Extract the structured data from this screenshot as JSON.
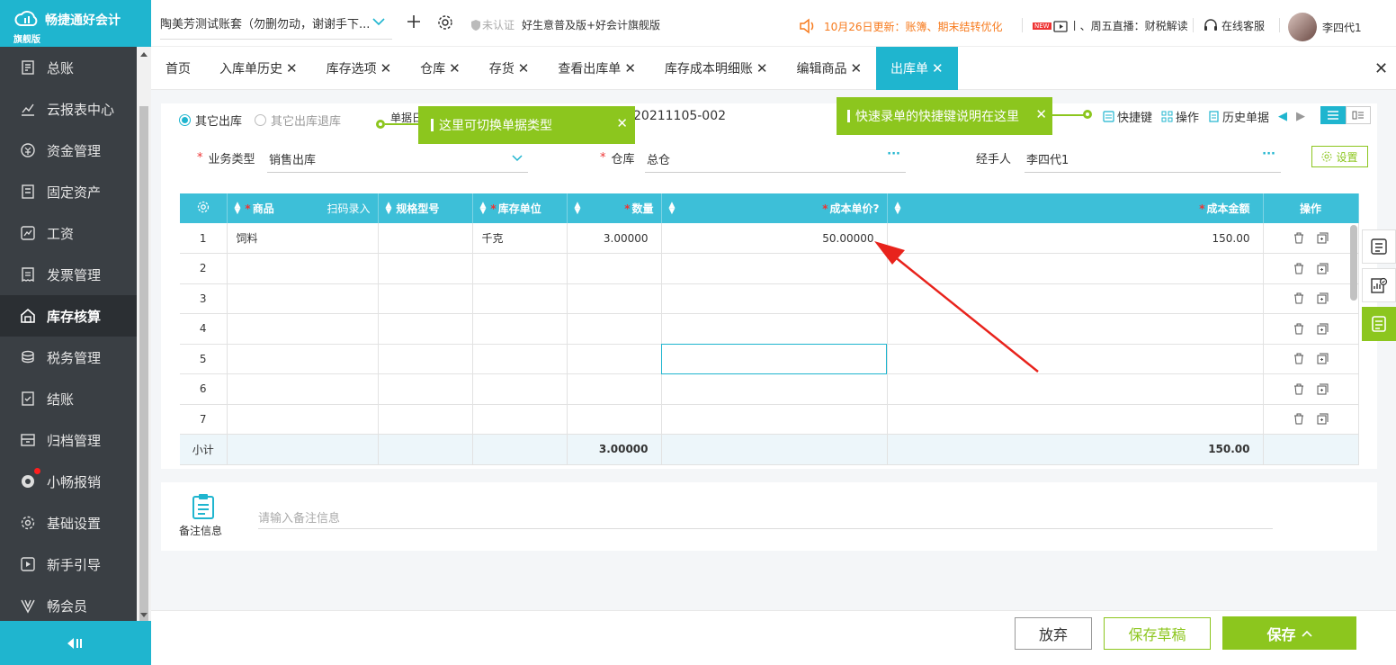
{
  "sidebar": {
    "brand": "畅捷通好会计",
    "brand_sub": "旗舰版",
    "items": [
      {
        "label": "总账",
        "icon": "ledger-icon"
      },
      {
        "label": "云报表中心",
        "icon": "chart-icon"
      },
      {
        "label": "资金管理",
        "icon": "money-icon"
      },
      {
        "label": "固定资产",
        "icon": "asset-icon"
      },
      {
        "label": "工资",
        "icon": "salary-icon"
      },
      {
        "label": "发票管理",
        "icon": "invoice-icon"
      },
      {
        "label": "库存核算",
        "icon": "warehouse-icon",
        "active": true
      },
      {
        "label": "税务管理",
        "icon": "tax-icon"
      },
      {
        "label": "结账",
        "icon": "closing-icon"
      },
      {
        "label": "归档管理",
        "icon": "archive-icon"
      },
      {
        "label": "小畅报销",
        "icon": "reimburse-icon"
      },
      {
        "label": "基础设置",
        "icon": "settings-icon"
      },
      {
        "label": "新手引导",
        "icon": "guide-icon"
      },
      {
        "label": "畅会员",
        "icon": "vip-icon"
      }
    ]
  },
  "topbar": {
    "account": "陶美芳测试账套（勿删勿动，谢谢手下...",
    "unauth": "未认证",
    "edition": "好生意普及版+好会计旗舰版",
    "notice": "10月26日更新：账簿、期末结转优化",
    "live_badge": "NEW",
    "live": "丨、周五直播：财税解读",
    "service": "在线客服",
    "user": "李四代1"
  },
  "tabs": [
    {
      "label": "首页",
      "closable": false
    },
    {
      "label": "入库单历史",
      "closable": true
    },
    {
      "label": "库存选项",
      "closable": true
    },
    {
      "label": "仓库",
      "closable": true
    },
    {
      "label": "存货",
      "closable": true
    },
    {
      "label": "查看出库单",
      "closable": true
    },
    {
      "label": "库存成本明细账",
      "closable": true
    },
    {
      "label": "编辑商品",
      "closable": true
    },
    {
      "label": "出库单",
      "closable": true,
      "active": true
    }
  ],
  "form": {
    "mode_other_out": "其它出库",
    "mode_other_return": "其它出库退库",
    "doc_no_label": "单据日",
    "doc_no": "20211105-002",
    "tip_switch": "这里可切换单据类型",
    "tip_shortcut": "快速录单的快捷键说明在这里",
    "tool_shortcut": "快捷键",
    "tool_ops": "操作",
    "tool_history": "历史单据",
    "biz_type_label": "业务类型",
    "biz_type": "销售出库",
    "warehouse_label": "仓库",
    "warehouse": "总仓",
    "handler_label": "经手人",
    "handler": "李四代1",
    "settings": "设置"
  },
  "grid": {
    "headers": {
      "goods": "商品",
      "scan": "扫码录入",
      "spec": "规格型号",
      "unit": "库存单位",
      "qty": "数量",
      "unit_cost": "成本单价",
      "amount": "成本金额",
      "ops": "操作"
    },
    "rows": [
      {
        "idx": "1",
        "goods": "饲料",
        "spec": "",
        "unit": "千克",
        "qty": "3.00000",
        "unit_cost": "50.00000",
        "amount": "150.00"
      },
      {
        "idx": "2",
        "goods": "",
        "spec": "",
        "unit": "",
        "qty": "",
        "unit_cost": "",
        "amount": ""
      },
      {
        "idx": "3",
        "goods": "",
        "spec": "",
        "unit": "",
        "qty": "",
        "unit_cost": "",
        "amount": ""
      },
      {
        "idx": "4",
        "goods": "",
        "spec": "",
        "unit": "",
        "qty": "",
        "unit_cost": "",
        "amount": ""
      },
      {
        "idx": "5",
        "goods": "",
        "spec": "",
        "unit": "",
        "qty": "",
        "unit_cost": "",
        "amount": ""
      },
      {
        "idx": "6",
        "goods": "",
        "spec": "",
        "unit": "",
        "qty": "",
        "unit_cost": "",
        "amount": ""
      },
      {
        "idx": "7",
        "goods": "",
        "spec": "",
        "unit": "",
        "qty": "",
        "unit_cost": "",
        "amount": ""
      }
    ],
    "subtotal": {
      "label": "小计",
      "qty": "3.00000",
      "amount": "150.00"
    }
  },
  "remark": {
    "label": "备注信息",
    "placeholder": "请输入备注信息"
  },
  "buttons": {
    "abandon": "放弃",
    "draft": "保存草稿",
    "save": "保存"
  },
  "colors": {
    "brand": "#1fb5cf",
    "accent": "#8cc61e",
    "sidebar": "#3a3f44",
    "notice": "#f77b1e",
    "annotation": "#e8231c"
  }
}
